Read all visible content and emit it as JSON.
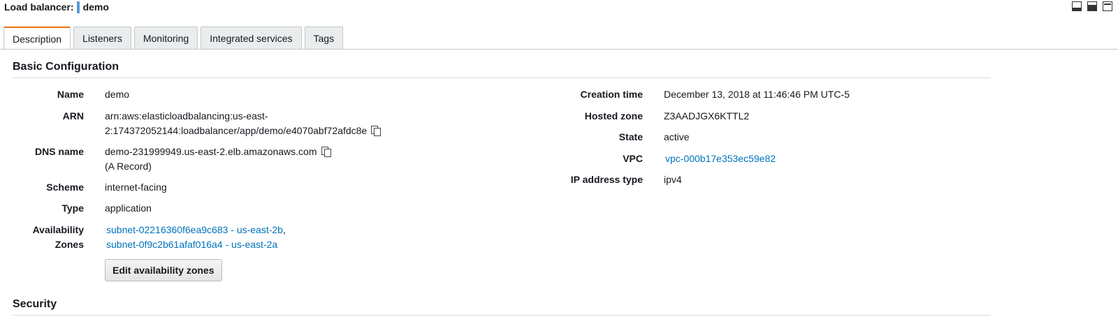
{
  "header": {
    "label": "Load balancer:",
    "name": "demo"
  },
  "tabs": [
    {
      "label": "Description",
      "active": true
    },
    {
      "label": "Listeners"
    },
    {
      "label": "Monitoring"
    },
    {
      "label": "Integrated services"
    },
    {
      "label": "Tags"
    }
  ],
  "basic": {
    "heading": "Basic Configuration",
    "left": {
      "name_label": "Name",
      "name_value": "demo",
      "arn_label": "ARN",
      "arn_line1": "arn:aws:elasticloadbalancing:us-east-",
      "arn_line2": "2:174372052144:loadbalancer/app/demo/e4070abf72afdc8e",
      "dns_label": "DNS name",
      "dns_line1": "demo-231999949.us-east-2.elb.amazonaws.com",
      "dns_line2": "(A Record)",
      "scheme_label": "Scheme",
      "scheme_value": "internet-facing",
      "type_label": "Type",
      "type_value": "application",
      "az_label_1": "Availability",
      "az_label_2": "Zones",
      "az_1": "subnet-02216360f6ea9c683 - us-east-2b",
      "az_sep": ",",
      "az_2": "subnet-0f9c2b61afaf016a4 - us-east-2a",
      "edit_button": "Edit availability zones"
    },
    "right": {
      "creation_label": "Creation time",
      "creation_value": "December 13, 2018 at 11:46:46 PM UTC-5",
      "hosted_label": "Hosted zone",
      "hosted_value": "Z3AADJGX6KTTL2",
      "state_label": "State",
      "state_value": "active",
      "vpc_label": "VPC",
      "vpc_value": "vpc-000b17e353ec59e82",
      "ip_label": "IP address type",
      "ip_value": "ipv4"
    }
  },
  "security": {
    "heading": "Security"
  },
  "colors": {
    "accent_tab": "#ec7211",
    "link": "#0073bb",
    "marker": "#5b9bd5"
  }
}
